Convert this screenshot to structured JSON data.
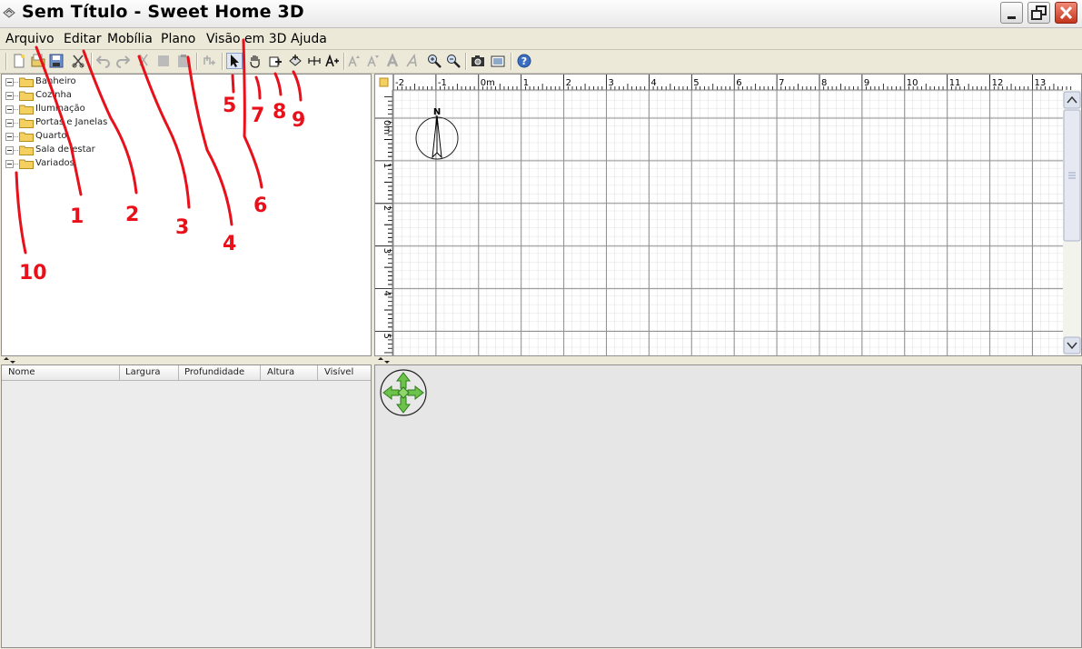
{
  "window": {
    "title": "Sem Título - Sweet Home 3D"
  },
  "menu": [
    "Arquivo",
    "Editar",
    "Mobília",
    "Plano",
    "Visão em 3D",
    "Ajuda"
  ],
  "toolbar": {
    "icons": [
      "new-icon",
      "open-icon",
      "save-icon",
      "cut-preferences-icon",
      "undo-icon",
      "redo-icon",
      "cut-icon",
      "copy-icon",
      "paste-icon",
      "add-furniture-icon",
      "select-icon",
      "pan-icon",
      "create-walls-icon",
      "create-rooms-icon",
      "create-dimensions-icon",
      "add-text-icon",
      "increase-text-icon",
      "decrease-text-icon",
      "bold-icon",
      "italic-icon",
      "zoom-in-icon",
      "zoom-out-icon",
      "photo-icon",
      "video-icon",
      "help-icon"
    ]
  },
  "catalog": {
    "categories": [
      "Banheiro",
      "Cozinha",
      "Iluminação",
      "Portas e Janelas",
      "Quarto",
      "Sala de estar",
      "Variados"
    ]
  },
  "furniture_table": {
    "columns": [
      "Nome",
      "Largura",
      "Profundidade",
      "Altura",
      "Visível"
    ]
  },
  "plan": {
    "x_ruler": [
      "-2",
      "-1",
      "0m",
      "1",
      "2",
      "3",
      "4",
      "5",
      "6",
      "7",
      "8",
      "9",
      "10",
      "11",
      "12",
      "13"
    ],
    "y_ruler": [
      "0m",
      "1",
      "2",
      "3",
      "4",
      "5"
    ],
    "compass_label": "N"
  },
  "annotations": [
    "1",
    "2",
    "3",
    "4",
    "5",
    "6",
    "7",
    "8",
    "9",
    "10"
  ],
  "colors": {
    "annotation": "#e8101a",
    "window_bg": "#ece9d8",
    "close_button": "#c4341d"
  }
}
